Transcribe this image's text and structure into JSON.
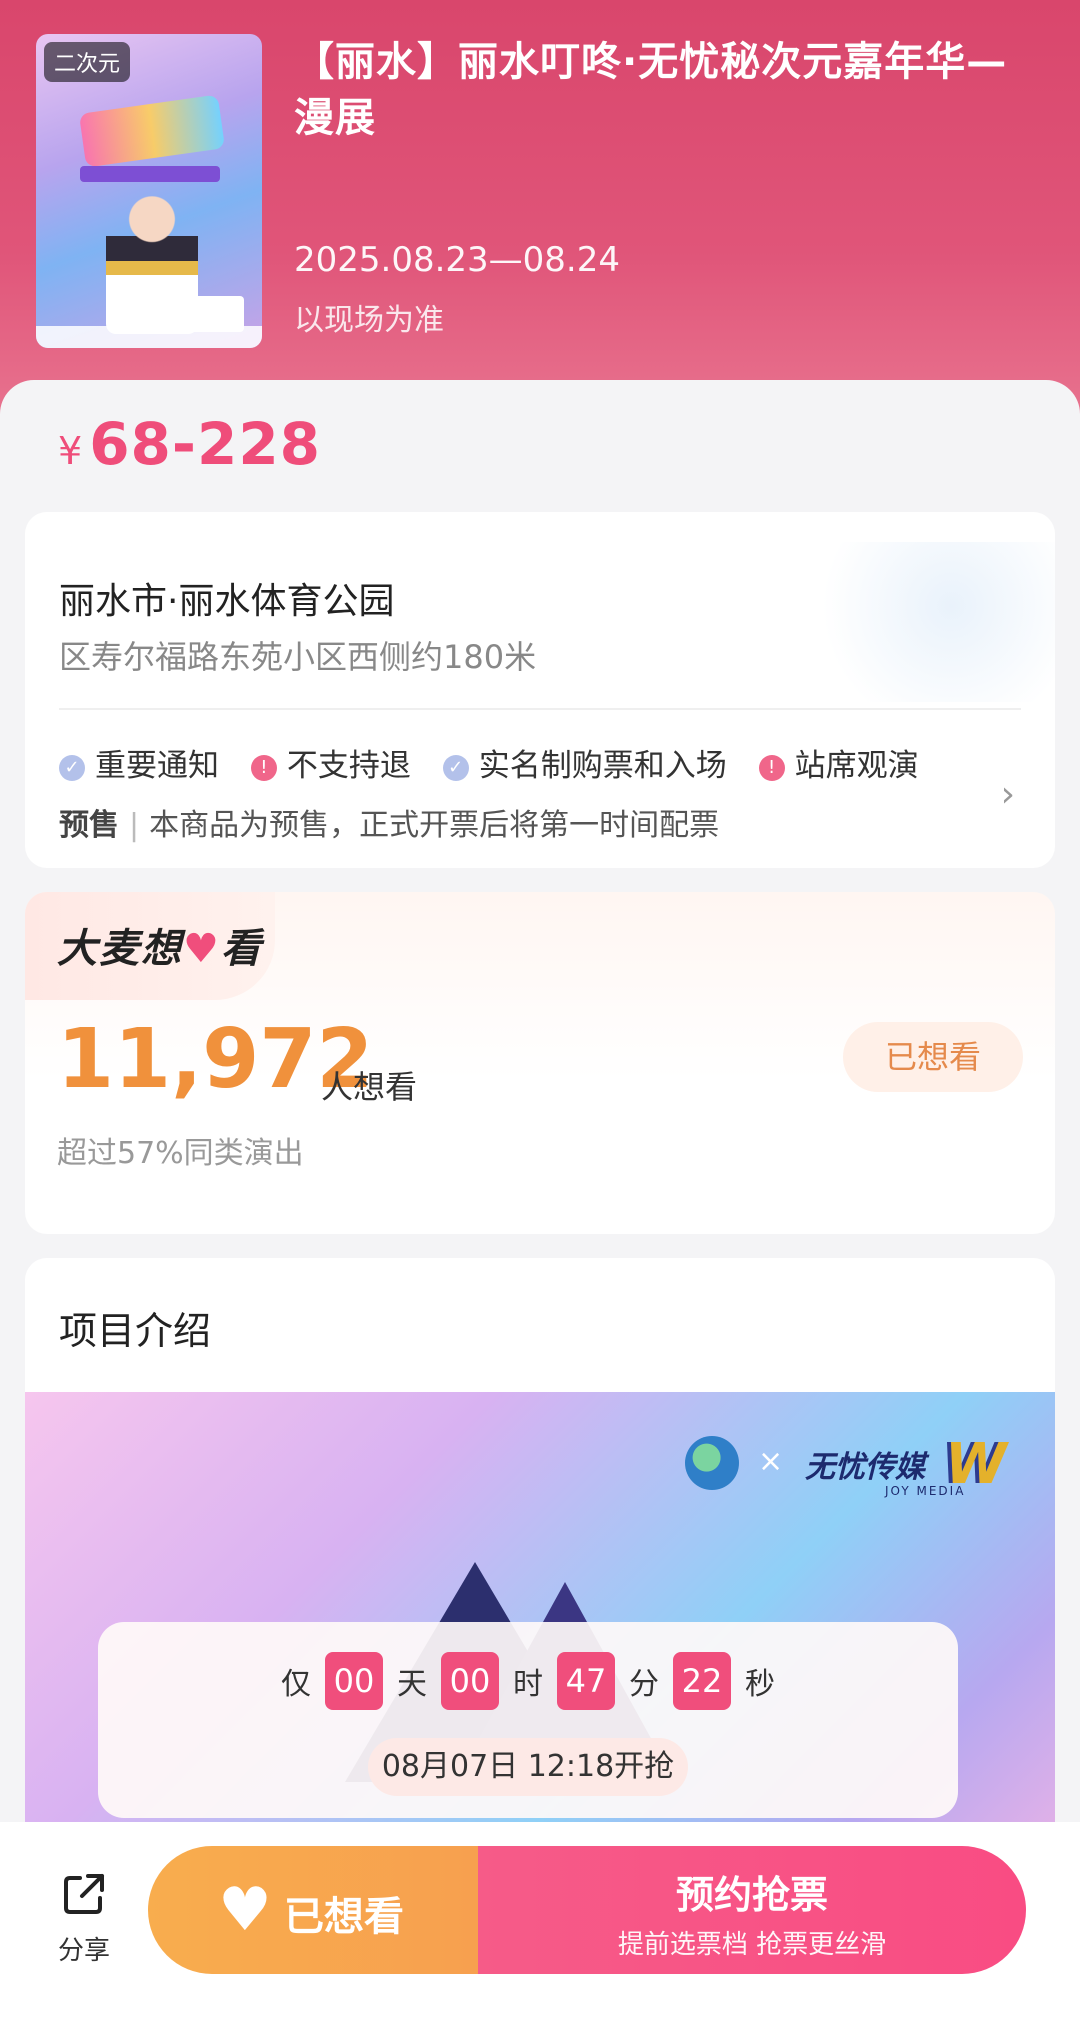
{
  "header": {
    "poster_tag": "二次元",
    "title": "【丽水】丽水叮咚·无忧秘次元嘉年华—漫展",
    "date": "2025.08.23—08.24",
    "date_note": "以现场为准"
  },
  "price": {
    "currency": "¥",
    "range": "68-228"
  },
  "venue": {
    "name": "丽水市·丽水体育公园",
    "address": "区寿尔福路东苑小区西侧约180米",
    "tags": [
      {
        "label": "重要通知",
        "icon": "info-icon"
      },
      {
        "label": "不支持退",
        "icon": "warning-icon"
      },
      {
        "label": "实名制购票和入场",
        "icon": "info-icon"
      },
      {
        "label": "站席观演",
        "icon": "warning-icon"
      }
    ],
    "presale_label": "预售",
    "presale_text": "本商品为预售，正式开票后将第一时间配票"
  },
  "want": {
    "badge_prefix": "大麦想",
    "badge_heart": "♥",
    "badge_suffix": "看",
    "count": "11,972",
    "count_unit": "人想看",
    "compare": "超过57%同类演出",
    "button": "已想看"
  },
  "intro": {
    "title": "项目介绍",
    "banner_x": "×",
    "banner_brand": "无忧传媒",
    "banner_brand_sub": "JOY MEDIA",
    "banner_logo_letter": "W"
  },
  "countdown": {
    "prefix": "仅",
    "days": "00",
    "days_unit": "天",
    "hours": "00",
    "hours_unit": "时",
    "minutes": "47",
    "minutes_unit": "分",
    "seconds": "22",
    "seconds_unit": "秒",
    "sale_time": "08月07日 12:18开抢"
  },
  "bottom": {
    "share_label": "分享",
    "want_label": "已想看",
    "book_label": "预约抢票",
    "book_sub": "提前选票档 抢票更丝滑"
  },
  "colors": {
    "header": "#d9466c",
    "price": "#ef4d7a",
    "count": "#f0913c",
    "want_button": "#f8ad4e",
    "book_button": "#f65b88"
  }
}
